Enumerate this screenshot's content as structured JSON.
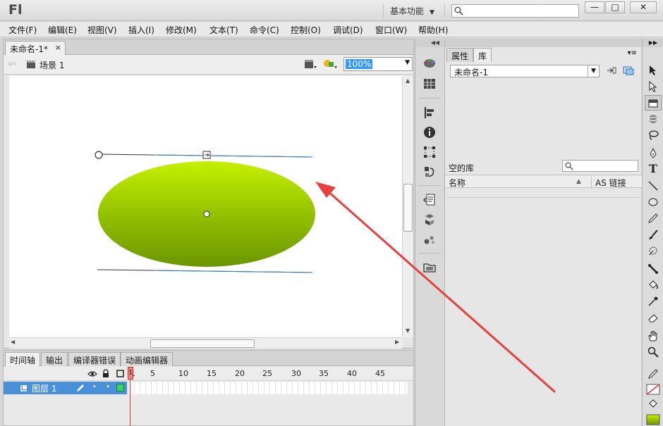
{
  "app": {
    "logo": "Fl",
    "workspace_label": "基本功能",
    "help_search_placeholder": ""
  },
  "window_controls": {
    "minimize": "—",
    "maximize": "□",
    "close": "✕"
  },
  "menu": [
    {
      "label": "文件(F)"
    },
    {
      "label": "编辑(E)"
    },
    {
      "label": "视图(V)"
    },
    {
      "label": "插入(I)"
    },
    {
      "label": "修改(M)"
    },
    {
      "label": "文本(T)"
    },
    {
      "label": "命令(C)"
    },
    {
      "label": "控制(O)"
    },
    {
      "label": "调试(D)"
    },
    {
      "label": "窗口(W)"
    },
    {
      "label": "帮助(H)"
    }
  ],
  "document": {
    "tab_title": "未命名-1*",
    "tab_close": "×",
    "scene_label": "场景 1",
    "zoom": "100%"
  },
  "stage": {
    "shape": "ellipse",
    "fill_gradient": [
      "#c6f000",
      "#8fbd00",
      "#6c9600"
    ],
    "annotation_arrow_color": "#e8403e"
  },
  "timeline": {
    "tabs": [
      {
        "label": "时间轴"
      },
      {
        "label": "输出"
      },
      {
        "label": "编译器错误"
      },
      {
        "label": "动画编辑器"
      }
    ],
    "frame_numbers": [
      "1",
      "5",
      "10",
      "15",
      "20",
      "25",
      "30",
      "35",
      "40",
      "45"
    ],
    "layer_name": "图层 1",
    "current_frame": "1"
  },
  "right_panel": {
    "tabs": [
      {
        "label": "属性"
      },
      {
        "label": "库"
      }
    ],
    "library_select": "未命名-1",
    "empty_library": "空的库",
    "columns": {
      "name": "名称",
      "linkage": "AS 链接"
    }
  },
  "icons": {
    "strip": [
      "color-palette-icon",
      "swatches-grid-icon",
      "align-icon",
      "info-icon",
      "transform-icon",
      "motion-presets-icon",
      "code-snippets-icon",
      "components-icon",
      "component-inspector-icon",
      "project-folder-icon"
    ],
    "tools": [
      "selection-tool-icon",
      "subselection-tool-icon",
      "free-transform-tool-icon",
      "3d-rotation-tool-icon",
      "lasso-tool-icon",
      "pen-tool-icon",
      "text-tool-icon",
      "line-tool-icon",
      "oval-tool-icon",
      "pencil-tool-icon",
      "brush-tool-icon",
      "deco-tool-icon",
      "bone-tool-icon",
      "paint-bucket-tool-icon",
      "eyedropper-tool-icon",
      "eraser-tool-icon",
      "hand-tool-icon",
      "zoom-tool-icon",
      "stroke-color-icon",
      "stroke-swatch-icon",
      "fill-color-icon",
      "fill-swatch-icon"
    ]
  }
}
